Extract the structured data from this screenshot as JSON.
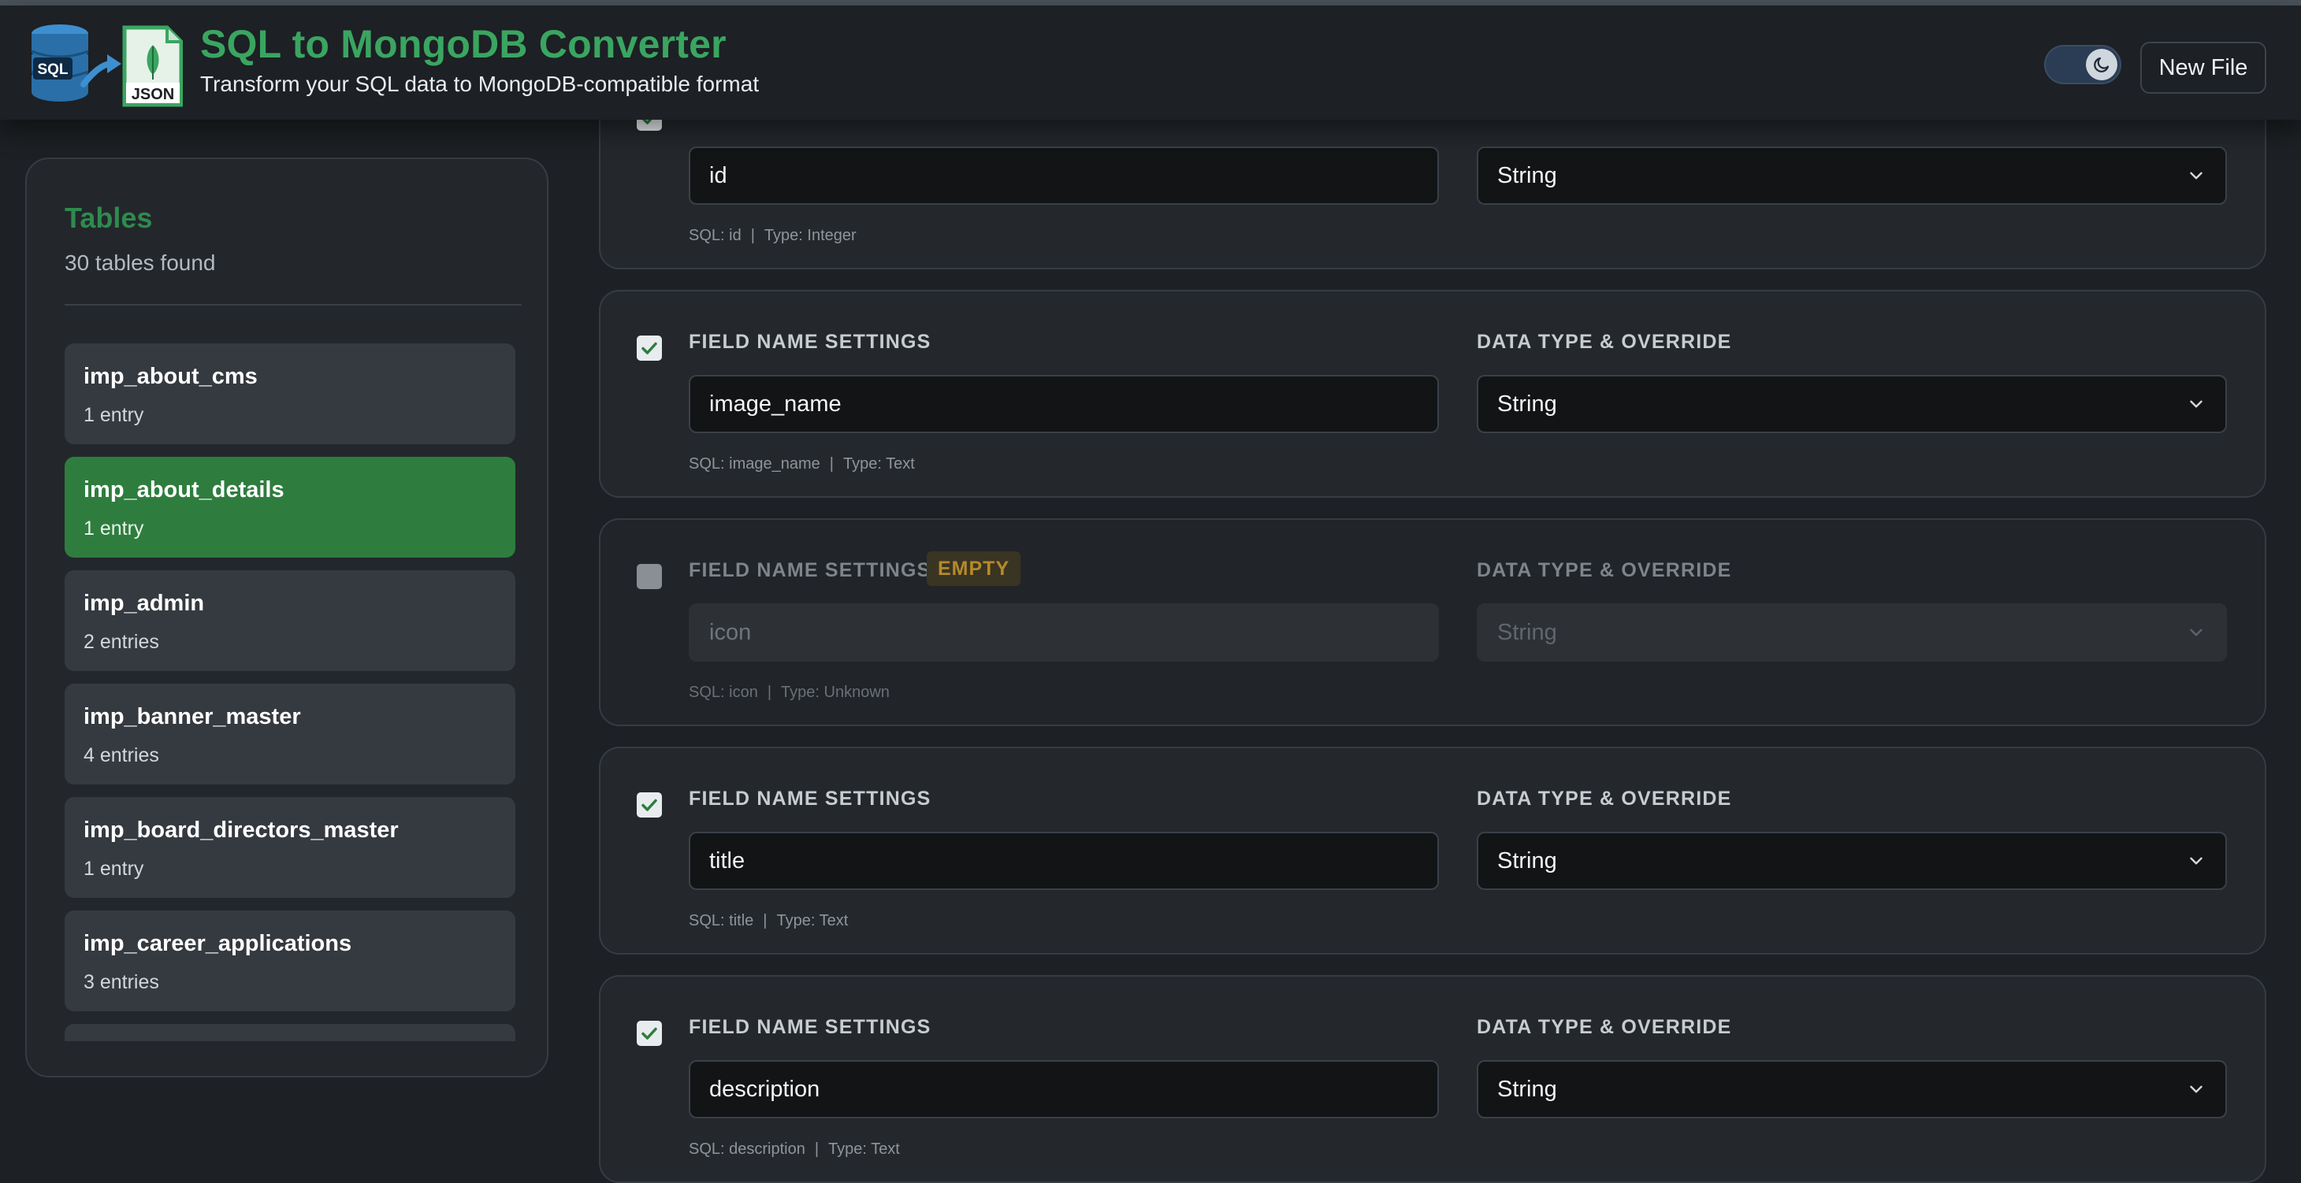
{
  "header": {
    "title": "SQL to MongoDB Converter",
    "subtitle": "Transform your SQL data to MongoDB-compatible format",
    "logo_sql_text": "SQL",
    "logo_json_text": "JSON",
    "new_file_label": "New File",
    "theme_icon": "moon-icon"
  },
  "sidebar": {
    "title": "Tables",
    "count_text": "30 tables found",
    "items": [
      {
        "name": "imp_about_cms",
        "entries": "1 entry"
      },
      {
        "name": "imp_about_details",
        "entries": "1 entry",
        "active": true
      },
      {
        "name": "imp_admin",
        "entries": "2 entries"
      },
      {
        "name": "imp_banner_master",
        "entries": "4 entries"
      },
      {
        "name": "imp_board_directors_master",
        "entries": "1 entry"
      },
      {
        "name": "imp_career_applications",
        "entries": "3 entries"
      }
    ]
  },
  "fields": {
    "label_left": "FIELD NAME SETTINGS",
    "label_right": "DATA TYPE & OVERRIDE",
    "empty_badge": "EMPTY",
    "sql_prefix": "SQL:",
    "type_prefix": "Type:",
    "items": [
      {
        "name": "id",
        "sql": "id",
        "sql_type": "Integer",
        "data_type": "String",
        "checked": true
      },
      {
        "name": "image_name",
        "sql": "image_name",
        "sql_type": "Text",
        "data_type": "String",
        "checked": true
      },
      {
        "name": "icon",
        "sql": "icon",
        "sql_type": "Unknown",
        "data_type": "String",
        "checked": false,
        "empty": true
      },
      {
        "name": "title",
        "sql": "title",
        "sql_type": "Text",
        "data_type": "String",
        "checked": true
      },
      {
        "name": "description",
        "sql": "description",
        "sql_type": "Text",
        "data_type": "String",
        "checked": true
      }
    ]
  },
  "colors": {
    "accent": "#3aa561",
    "active_item": "#2e7d3e",
    "background": "#1d2024",
    "empty_badge": "#b48a2c"
  }
}
